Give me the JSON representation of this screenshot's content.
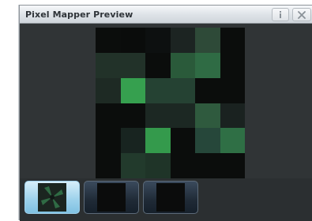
{
  "window": {
    "title": "Pixel Mapper Preview",
    "buttons": [
      {
        "name": "info",
        "icon": "info-icon"
      },
      {
        "name": "close",
        "icon": "close-icon"
      }
    ]
  },
  "preview": {
    "rows": 6,
    "cols": 6,
    "pixels": [
      [
        "#0b0d0c",
        "#0a0c0b",
        "#0d1010",
        "#1c2422",
        "#2e4a38",
        "#0b0d0c"
      ],
      [
        "#223229",
        "#223229",
        "#0b0d0c",
        "#2a5a3a",
        "#2f6b44",
        "#0b0d0c"
      ],
      [
        "#1e2a24",
        "#36a04f",
        "#254233",
        "#254233",
        "#0b0d0c",
        "#0b0d0c"
      ],
      [
        "#0b0d0c",
        "#0b0d0c",
        "#1c2823",
        "#1c2823",
        "#2f5a3e",
        "#1a2220"
      ],
      [
        "#0b0d0c",
        "#182420",
        "#349a4c",
        "#0b0d0c",
        "#26473a",
        "#2f6f45"
      ],
      [
        "#0b0d0c",
        "#223a2c",
        "#1f3428",
        "#0b0d0c",
        "#0b0d0c",
        "#0b0d0c"
      ]
    ]
  },
  "thumbnails": [
    {
      "selected": true
    },
    {
      "selected": false
    },
    {
      "selected": false
    }
  ]
}
